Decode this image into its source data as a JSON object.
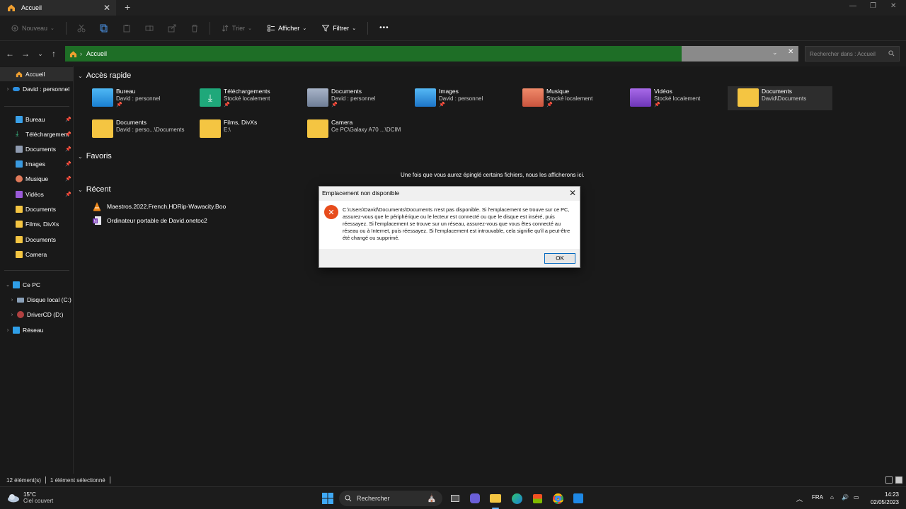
{
  "window": {
    "tab_title": "Accueil",
    "new_tab": "+",
    "close_tab": "✕"
  },
  "toolbar": {
    "new_label": "Nouveau",
    "sort_label": "Trier",
    "view_label": "Afficher",
    "filter_label": "Filtrer",
    "more_label": "•••"
  },
  "address": {
    "crumb": "Accueil",
    "search_placeholder": "Rechercher dans : Accueil"
  },
  "sidebar": {
    "items": [
      {
        "label": "Accueil"
      },
      {
        "label": "David : personnel"
      },
      {
        "label": "Bureau"
      },
      {
        "label": "Téléchargement"
      },
      {
        "label": "Documents"
      },
      {
        "label": "Images"
      },
      {
        "label": "Musique"
      },
      {
        "label": "Vidéos"
      },
      {
        "label": "Documents"
      },
      {
        "label": "Films, DivXs"
      },
      {
        "label": "Documents"
      },
      {
        "label": "Camera"
      },
      {
        "label": "Ce PC"
      },
      {
        "label": "Disque local (C:)"
      },
      {
        "label": "DriverCD (D:)"
      },
      {
        "label": "Réseau"
      }
    ]
  },
  "main": {
    "quick_access_title": "Accès rapide",
    "favorites_title": "Favoris",
    "recent_title": "Récent",
    "favorites_empty": "Une fois que vous aurez épinglé certains fichiers, nous les afficherons ici.",
    "quick_access": [
      {
        "name": "Bureau",
        "sub": "David : personnel",
        "pinned": "📌"
      },
      {
        "name": "Téléchargements",
        "sub": "Stocké localement",
        "pinned": "📌"
      },
      {
        "name": "Documents",
        "sub": "David : personnel",
        "pinned": "📌"
      },
      {
        "name": "Images",
        "sub": "David : personnel",
        "pinned": "📌"
      },
      {
        "name": "Musique",
        "sub": "Stocké localement",
        "pinned": "📌"
      },
      {
        "name": "Vidéos",
        "sub": "Stocké localement",
        "pinned": "📌"
      },
      {
        "name": "Documents",
        "sub": "David\\Documents",
        "pinned": ""
      },
      {
        "name": "Documents",
        "sub": "David : perso...\\Documents",
        "pinned": ""
      },
      {
        "name": "Films, DivXs",
        "sub": "E:\\",
        "pinned": ""
      },
      {
        "name": "Camera",
        "sub": "Ce PC\\Galaxy A70 ...\\DCIM",
        "pinned": ""
      }
    ],
    "recent": [
      {
        "name": "Maestros.2022.French.HDRip-Wawacity.Boo"
      },
      {
        "name": "Ordinateur portable de David.onetoc2"
      }
    ]
  },
  "dialog": {
    "title": "Emplacement non disponible",
    "message": "C:\\Users\\David\\Documents\\Documents n'est pas disponible. Si l'emplacement se trouve sur ce PC, assurez-vous que le périphérique ou le lecteur est connecté ou que le disque est inséré, puis réessayez. Si l'emplacement se trouve sur un réseau, assurez-vous que vous êtes connecté au réseau ou à Internet, puis réessayez. Si l'emplacement est introuvable, cela signifie qu'il a peut-être été changé ou supprimé.",
    "ok_label": "OK",
    "close": "✕"
  },
  "status": {
    "count": "12 élément(s)",
    "selected": "1 élément sélectionné"
  },
  "taskbar": {
    "temp": "15°C",
    "condition": "Ciel couvert",
    "search_label": "Rechercher",
    "lang": "FRA",
    "time": "14:23",
    "date": "02/05/2023"
  },
  "colors": {
    "address_highlight": "#1e6e26",
    "error_icon": "#e74c1c",
    "folder_yellow": "#f4c542"
  }
}
